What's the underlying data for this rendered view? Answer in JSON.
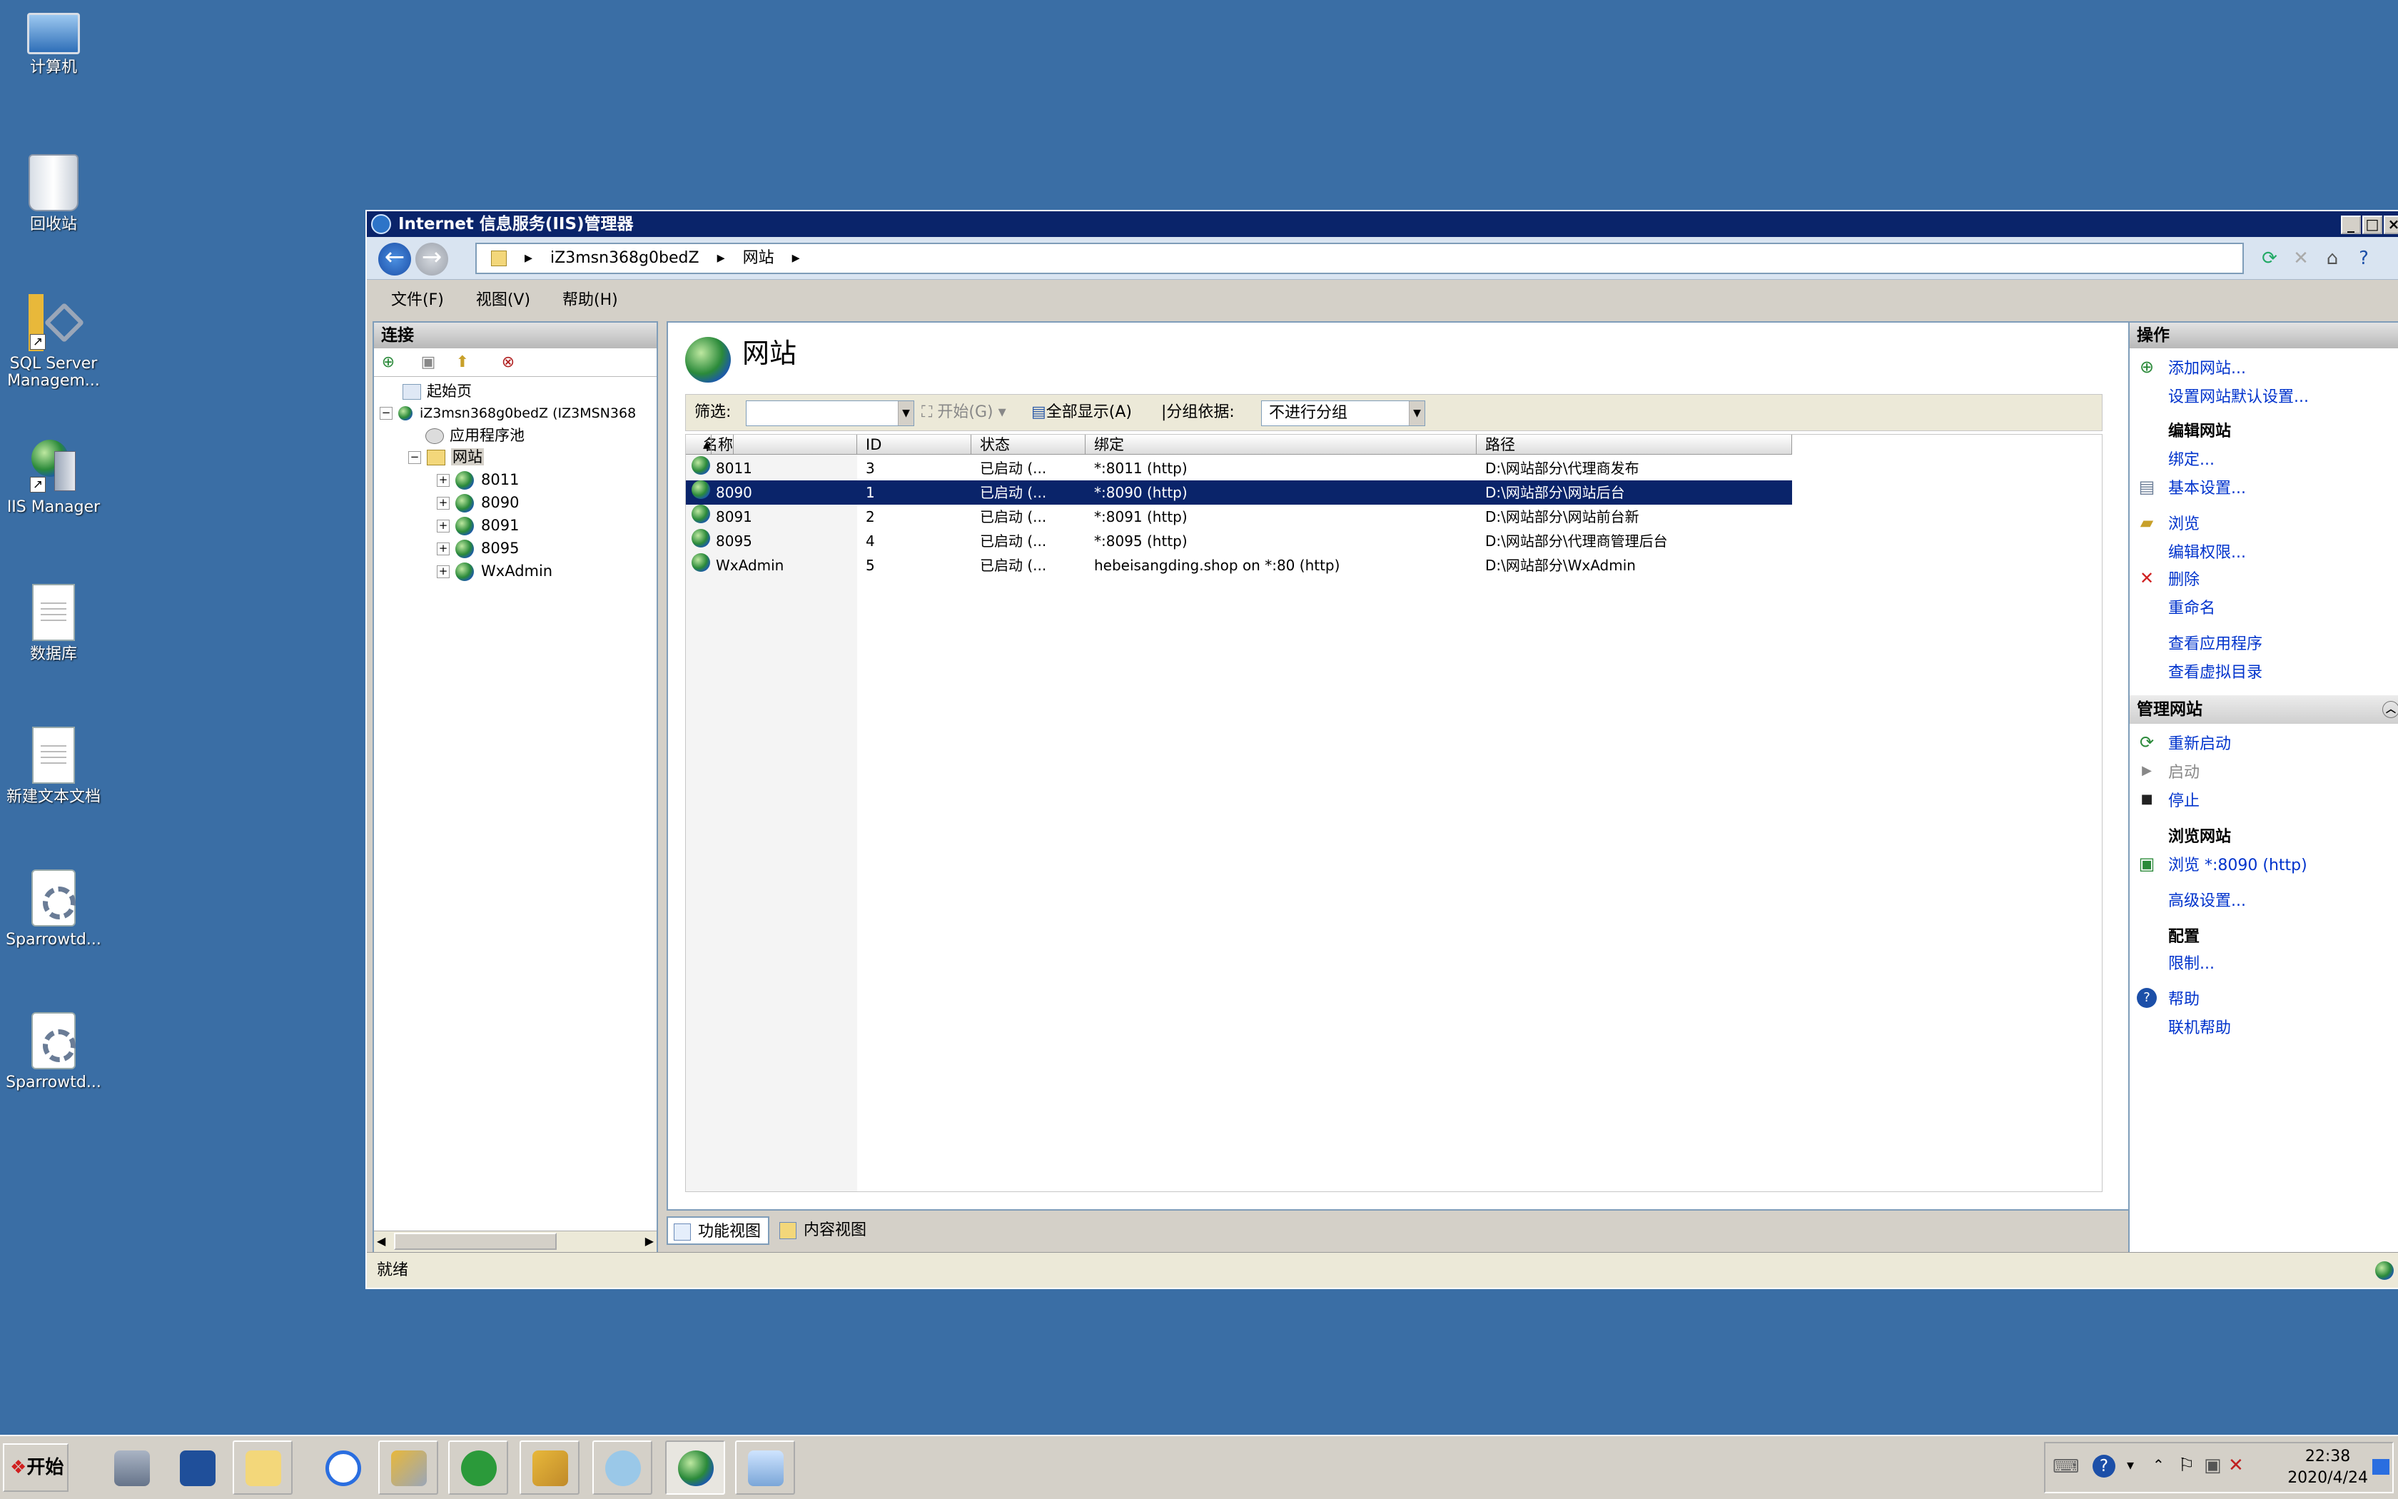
{
  "desktop": {
    "icons": [
      {
        "label": "计算机",
        "icon": "computer-icon"
      },
      {
        "label": "回收站",
        "icon": "recycle-bin-icon"
      },
      {
        "label": "SQL Server Managem...",
        "icon": "sql-server-icon"
      },
      {
        "label": "IIS Manager",
        "icon": "iis-manager-icon"
      },
      {
        "label": "数据库",
        "icon": "document-icon"
      },
      {
        "label": "新建文本文档",
        "icon": "text-document-icon"
      },
      {
        "label": "Sparrowtd...",
        "icon": "gear-document-icon"
      },
      {
        "label": "Sparrowtd...",
        "icon": "gear-document-icon"
      }
    ]
  },
  "window": {
    "title": "Internet 信息服务(IIS)管理器",
    "breadcrumb": [
      "iZ3msn368g0bedZ",
      "网站"
    ],
    "menu": [
      "文件(F)",
      "视图(V)",
      "帮助(H)"
    ]
  },
  "connections": {
    "title": "连接",
    "tree": {
      "start_page": "起始页",
      "server": "iZ3msn368g0bedZ (IZ3MSN368",
      "app_pools": "应用程序池",
      "sites": "网站",
      "site_items": [
        "8011",
        "8090",
        "8091",
        "8095",
        "WxAdmin"
      ]
    }
  },
  "center": {
    "heading": "网站",
    "filter_label": "筛选:",
    "filter_value": "",
    "go_label": "开始(G)",
    "show_all_label": "全部显示(A)",
    "group_by_label": "分组依据:",
    "group_by_value": "不进行分组",
    "columns": [
      "名称",
      "ID",
      "状态",
      "绑定",
      "路径"
    ],
    "rows": [
      {
        "name": "8011",
        "id": "3",
        "status": "已启动 (...",
        "binding": "*:8011 (http)",
        "path": "D:\\网站部分\\代理商发布",
        "selected": false
      },
      {
        "name": "8090",
        "id": "1",
        "status": "已启动 (...",
        "binding": "*:8090 (http)",
        "path": "D:\\网站部分\\网站后台",
        "selected": true
      },
      {
        "name": "8091",
        "id": "2",
        "status": "已启动 (...",
        "binding": "*:8091 (http)",
        "path": "D:\\网站部分\\网站前台新",
        "selected": false
      },
      {
        "name": "8095",
        "id": "4",
        "status": "已启动 (...",
        "binding": "*:8095 (http)",
        "path": "D:\\网站部分\\代理商管理后台",
        "selected": false
      },
      {
        "name": "WxAdmin",
        "id": "5",
        "status": "已启动 (...",
        "binding": "hebeisangding.shop on *:80 (http)",
        "path": "D:\\网站部分\\WxAdmin",
        "selected": false
      }
    ],
    "view_tabs": [
      "功能视图",
      "内容视图"
    ]
  },
  "status_text": "就绪",
  "actions": {
    "title": "操作",
    "add_site": "添加网站...",
    "set_defaults": "设置网站默认设置...",
    "edit_site_heading": "编辑网站",
    "bindings": "绑定...",
    "basic_settings": "基本设置...",
    "explore": "浏览",
    "edit_permissions": "编辑权限...",
    "remove": "删除",
    "rename": "重命名",
    "view_apps": "查看应用程序",
    "view_vdirs": "查看虚拟目录",
    "manage_heading": "管理网站",
    "restart": "重新启动",
    "start": "启动",
    "stop": "停止",
    "browse_heading": "浏览网站",
    "browse_link": "浏览 *:8090 (http)",
    "advanced": "高级设置...",
    "config_heading": "配置",
    "limits": "限制...",
    "help": "帮助",
    "online_help": "联机帮助"
  },
  "taskbar": {
    "start_label": "开始",
    "time": "22:38",
    "date": "2020/4/24"
  },
  "colors": {
    "desktop": "#3a6ea5",
    "titlebar": "#0a246a",
    "selection": "#0a246a",
    "link": "#0033cc"
  }
}
